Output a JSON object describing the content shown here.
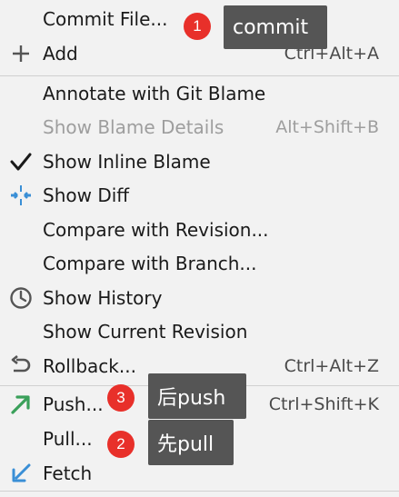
{
  "menu": {
    "items": [
      {
        "label": "Commit File...",
        "shortcut": "",
        "icon": "none",
        "disabled": false
      },
      {
        "label": "Add",
        "shortcut": "Ctrl+Alt+A",
        "icon": "plus-icon",
        "disabled": false
      },
      {
        "label": "Annotate with Git Blame",
        "shortcut": "",
        "icon": "none",
        "disabled": false
      },
      {
        "label": "Show Blame Details",
        "shortcut": "Alt+Shift+B",
        "icon": "none",
        "disabled": true
      },
      {
        "label": "Show Inline Blame",
        "shortcut": "",
        "icon": "checkmark-icon",
        "disabled": false
      },
      {
        "label": "Show Diff",
        "shortcut": "",
        "icon": "diff-arrows-icon",
        "disabled": false
      },
      {
        "label": "Compare with Revision...",
        "shortcut": "",
        "icon": "none",
        "disabled": false
      },
      {
        "label": "Compare with Branch...",
        "shortcut": "",
        "icon": "none",
        "disabled": false
      },
      {
        "label": "Show History",
        "shortcut": "",
        "icon": "clock-icon",
        "disabled": false
      },
      {
        "label": "Show Current Revision",
        "shortcut": "",
        "icon": "none",
        "disabled": false
      },
      {
        "label": "Rollback...",
        "shortcut": "Ctrl+Alt+Z",
        "icon": "undo-icon",
        "disabled": false
      },
      {
        "label": "Push...",
        "shortcut": "Ctrl+Shift+K",
        "icon": "push-arrow-icon",
        "disabled": false
      },
      {
        "label": "Pull...",
        "shortcut": "",
        "icon": "none",
        "disabled": false
      },
      {
        "label": "Fetch",
        "shortcut": "",
        "icon": "fetch-arrow-icon",
        "disabled": false
      }
    ]
  },
  "annotations": {
    "commit": {
      "number": "1",
      "text": "commit"
    },
    "push": {
      "number": "3",
      "text": "后push"
    },
    "pull": {
      "number": "2",
      "text": "先pull"
    }
  },
  "colors": {
    "menu_background": "#f2f2f2",
    "disabled_text": "#9e9e9e",
    "badge": "#e8302a",
    "callout": "#555555",
    "diff_icon": "#3a8fd6",
    "push_icon": "#3aa05a",
    "fetch_icon": "#3a8fd6"
  }
}
